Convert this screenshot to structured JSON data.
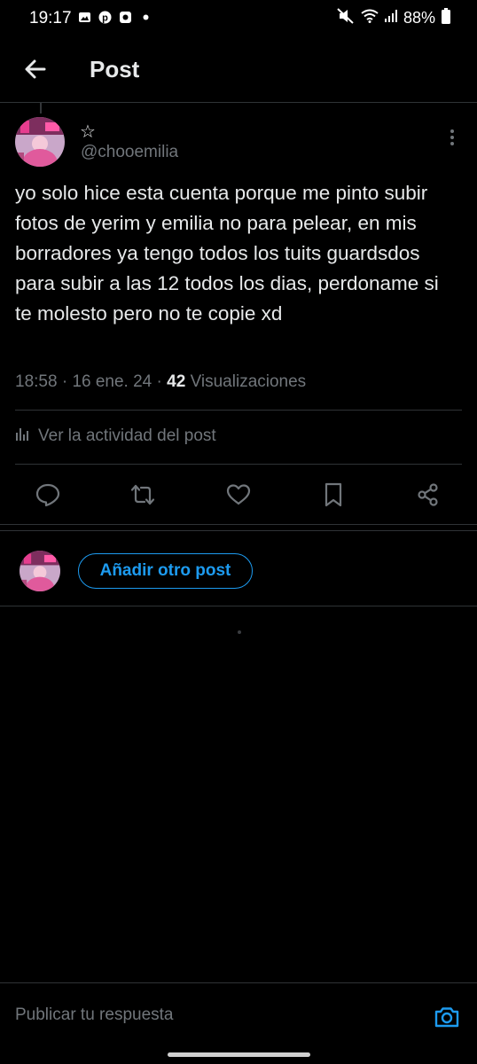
{
  "status_bar": {
    "time": "19:17",
    "battery": "88%",
    "left_icons": [
      "gallery-icon",
      "pinterest-icon",
      "app-icon",
      "dot-icon"
    ],
    "right_icons": [
      "mute-icon",
      "wifi-icon",
      "signal-icon",
      "battery-icon"
    ]
  },
  "header": {
    "title": "Post"
  },
  "post": {
    "display_name": "☆",
    "handle": "@chooemilia",
    "text": "yo solo hice esta cuenta porque me pinto subir fotos de yerim y emilia no para pelear, en mis borradores ya tengo todos los tuits guardsdos para subir a las 12 todos los dias, perdoname si te molesto pero no te copie xd",
    "time": "18:58",
    "date": "16 ene. 24",
    "views_count": "42",
    "views_label": "Visualizaciones",
    "activity_label": "Ver la actividad del post"
  },
  "actions": [
    "reply-icon",
    "repost-icon",
    "like-icon",
    "bookmark-icon",
    "share-icon"
  ],
  "add_post_label": "Añadir otro post",
  "compose": {
    "placeholder": "Publicar tu respuesta"
  },
  "colors": {
    "background": "#000000",
    "text": "#e7e9ea",
    "secondary": "#71767b",
    "accent": "#1d9bf0",
    "border": "#2f3336"
  }
}
